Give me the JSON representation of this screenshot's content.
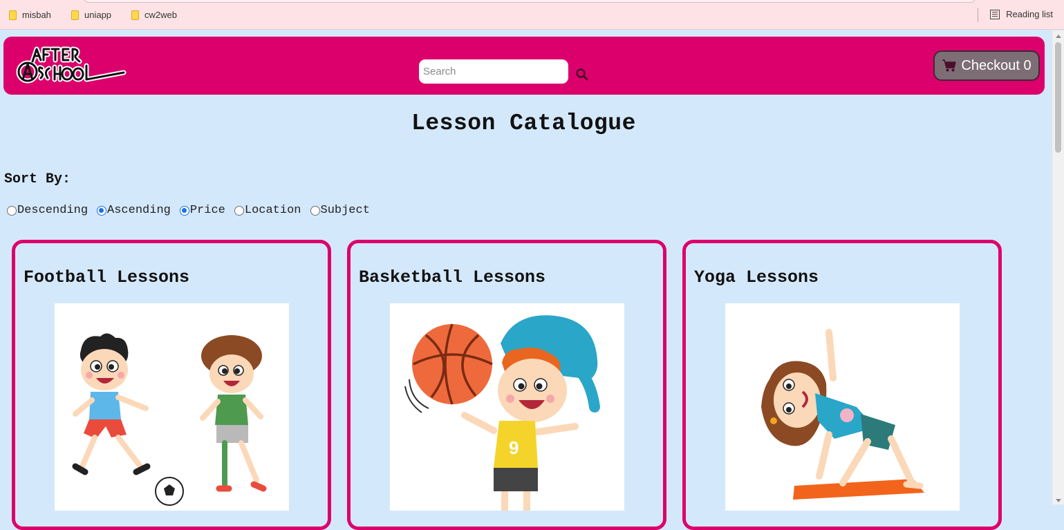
{
  "browser": {
    "bookmarks": [
      "misbah",
      "uniapp",
      "cw2web"
    ],
    "reading_list": "Reading list"
  },
  "header": {
    "logo_text": "AFTER SCHOOL",
    "search_placeholder": "Search",
    "checkout_label": "Checkout 0",
    "accent_color": "#dc006c"
  },
  "main": {
    "title": "Lesson Catalogue",
    "sort_label": "Sort By:",
    "sort_options": [
      {
        "label": "Descending",
        "checked": false
      },
      {
        "label": "Ascending",
        "checked": true
      },
      {
        "label": "Price",
        "checked": true
      },
      {
        "label": "Location",
        "checked": false
      },
      {
        "label": "Subject",
        "checked": false
      }
    ]
  },
  "lessons": [
    {
      "title": "Football Lessons",
      "image": "kids-playing-football"
    },
    {
      "title": "Basketball Lessons",
      "image": "boy-with-basketball"
    },
    {
      "title": "Yoga Lessons",
      "image": "girl-doing-yoga"
    }
  ],
  "colors": {
    "page_bg": "#d4e8fb",
    "bookmarks_bg": "#fde3e6",
    "checkout_bg": "#7d6e76"
  }
}
